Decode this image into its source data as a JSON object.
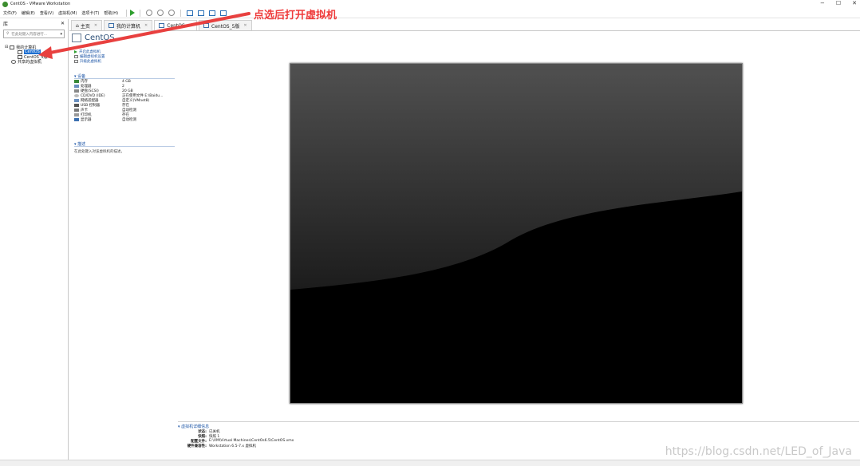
{
  "window": {
    "title": "CentOS - VMware Workstation",
    "controls": [
      "−",
      "☐",
      "✕"
    ]
  },
  "menu": [
    "文件(F)",
    "编辑(E)",
    "查看(V)",
    "虚拟机(M)",
    "选项卡(T)",
    "帮助(H)"
  ],
  "sidebar": {
    "header": "库",
    "close": "✕",
    "search_placeholder": "在此处键入内容进行...",
    "tree": [
      {
        "label": "我的计算机",
        "level": 0,
        "selected": false
      },
      {
        "label": "CentOS",
        "level": 1,
        "selected": true
      },
      {
        "label": "CentOS_5版",
        "level": 1,
        "selected": false
      },
      {
        "label": "共享的虚拟机",
        "level": 0,
        "selected": false
      }
    ]
  },
  "tabs": [
    {
      "label": "主页",
      "active": false
    },
    {
      "label": "我的计算机",
      "active": false
    },
    {
      "label": "CentOS",
      "active": true
    },
    {
      "label": "CentOS_5版",
      "active": false
    }
  ],
  "vm": {
    "title": "CentOS",
    "actions": [
      "开启此虚拟机",
      "编辑虚拟机设置",
      "升级此虚拟机"
    ],
    "devices_header": "设备",
    "devices": [
      {
        "name": "内存",
        "value": "4 GB"
      },
      {
        "name": "处理器",
        "value": "2"
      },
      {
        "name": "硬盘(SCSI)",
        "value": "20 GB"
      },
      {
        "name": "CD/DVD (IDE)",
        "value": "正在使用文件 E:\\Baidu..."
      },
      {
        "name": "网络适配器",
        "value": "自定义(VMnet8)"
      },
      {
        "name": "USB 控制器",
        "value": "存在"
      },
      {
        "name": "声卡",
        "value": "自动检测"
      },
      {
        "name": "打印机",
        "value": "存在"
      },
      {
        "name": "显示器",
        "value": "自动检测"
      }
    ],
    "description_header": "描述",
    "description": "在此处键入对该虚拟机的描述。",
    "details_header": "虚拟机详细信息",
    "details": [
      {
        "label": "状态:",
        "value": "已关机"
      },
      {
        "label": "快照:",
        "value": "快照 1"
      },
      {
        "label": "配置文件:",
        "value": "E:\\VM\\Virtual Machines\\CentOs6.5\\CentOS.vmx"
      },
      {
        "label": "硬件兼容性:",
        "value": "Workstation 6.5-7.x 虚拟机"
      }
    ]
  },
  "annotation": "点选后打开虚拟机",
  "watermark": "https://blog.csdn.net/LED_of_Java",
  "colors": {
    "accent": "#1e6fd0",
    "annotation": "#ef3b3b",
    "screen": "#000000"
  }
}
